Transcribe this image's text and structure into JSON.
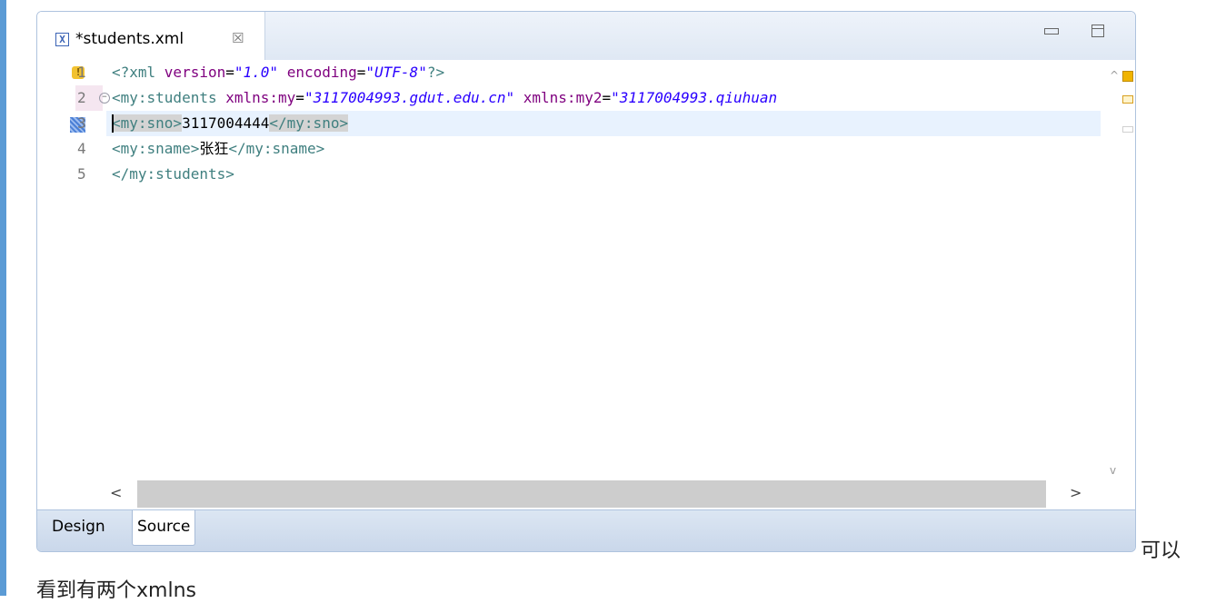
{
  "editor": {
    "tab_title": "*students.xml",
    "tab_close": "☒",
    "file_icon": "X",
    "bottom_tabs": [
      "Design",
      "Source"
    ],
    "active_bottom_tab": "Source"
  },
  "lines": [
    {
      "num": "1",
      "warning": true,
      "segments": [
        {
          "cls": "pi",
          "text": "<?xml "
        },
        {
          "cls": "attr",
          "text": "version"
        },
        {
          "cls": "",
          "text": "="
        },
        {
          "cls": "val",
          "text": "\"1.0\""
        },
        {
          "cls": "",
          "text": " "
        },
        {
          "cls": "attr",
          "text": "encoding"
        },
        {
          "cls": "",
          "text": "="
        },
        {
          "cls": "val",
          "text": "\"UTF-8\""
        },
        {
          "cls": "pi",
          "text": "?>"
        }
      ]
    },
    {
      "num": "2",
      "folded": true,
      "segments": [
        {
          "cls": "tag",
          "text": "<my:students "
        },
        {
          "cls": "attr",
          "text": "xmlns:my"
        },
        {
          "cls": "",
          "text": "="
        },
        {
          "cls": "val",
          "text": "\"3117004993.gdut.edu.cn\""
        },
        {
          "cls": "",
          "text": " "
        },
        {
          "cls": "attr",
          "text": "xmlns:my2"
        },
        {
          "cls": "",
          "text": "="
        },
        {
          "cls": "val",
          "text": "\"3117004993.qiuhuan"
        }
      ]
    },
    {
      "num": "3",
      "current": true,
      "segments": [
        {
          "cls": "tag hl",
          "text": "<my:sno>"
        },
        {
          "cls": "",
          "text": "3117004444"
        },
        {
          "cls": "tag hl",
          "text": "</my:sno>"
        }
      ]
    },
    {
      "num": "4",
      "segments": [
        {
          "cls": "tag",
          "text": "<my:sname>"
        },
        {
          "cls": "",
          "text": "张狂"
        },
        {
          "cls": "tag",
          "text": "</my:sname>"
        }
      ]
    },
    {
      "num": "5",
      "segments": [
        {
          "cls": "tag",
          "text": "</my:students>"
        }
      ]
    }
  ],
  "paragraph": {
    "text_part1": "可以",
    "text_part2": "看到有两个xmlns"
  }
}
